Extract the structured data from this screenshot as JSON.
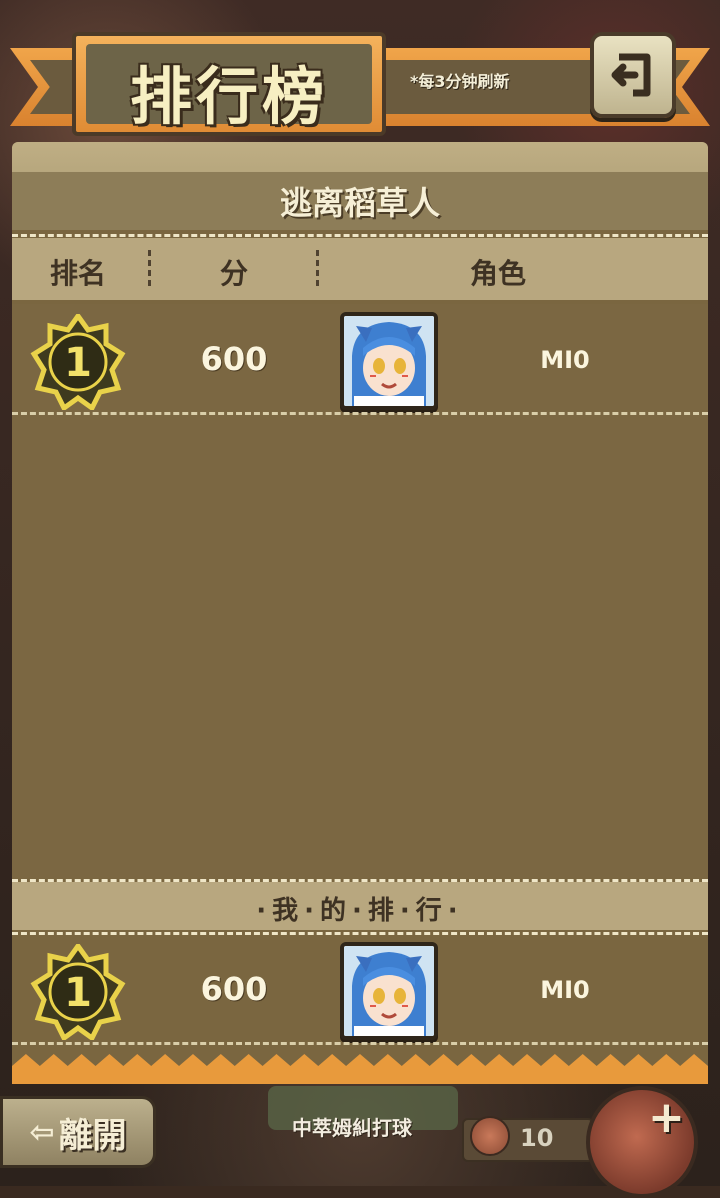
{
  "header": {
    "title": "排行榜",
    "refresh_note": "*每3分钟刷新",
    "back_icon": "back-return-icon"
  },
  "panel": {
    "stage_name": "逃离稻草人",
    "columns": {
      "rank": "排名",
      "score": "分",
      "character": "角色"
    },
    "rows": [
      {
        "rank": "1",
        "score": "600",
        "name": "MI0"
      }
    ],
    "my_rank": {
      "title": "·我·的·排·行·",
      "rank": "1",
      "score": "600",
      "name": "MI0"
    }
  },
  "footer": {
    "leave_label": "離開",
    "banner_text": "中萃姆糾打球",
    "coin_count": "10"
  },
  "colors": {
    "banner_orange": "#e08c35",
    "panel": "#7b6742",
    "medal_gold": "#e9d24a"
  }
}
